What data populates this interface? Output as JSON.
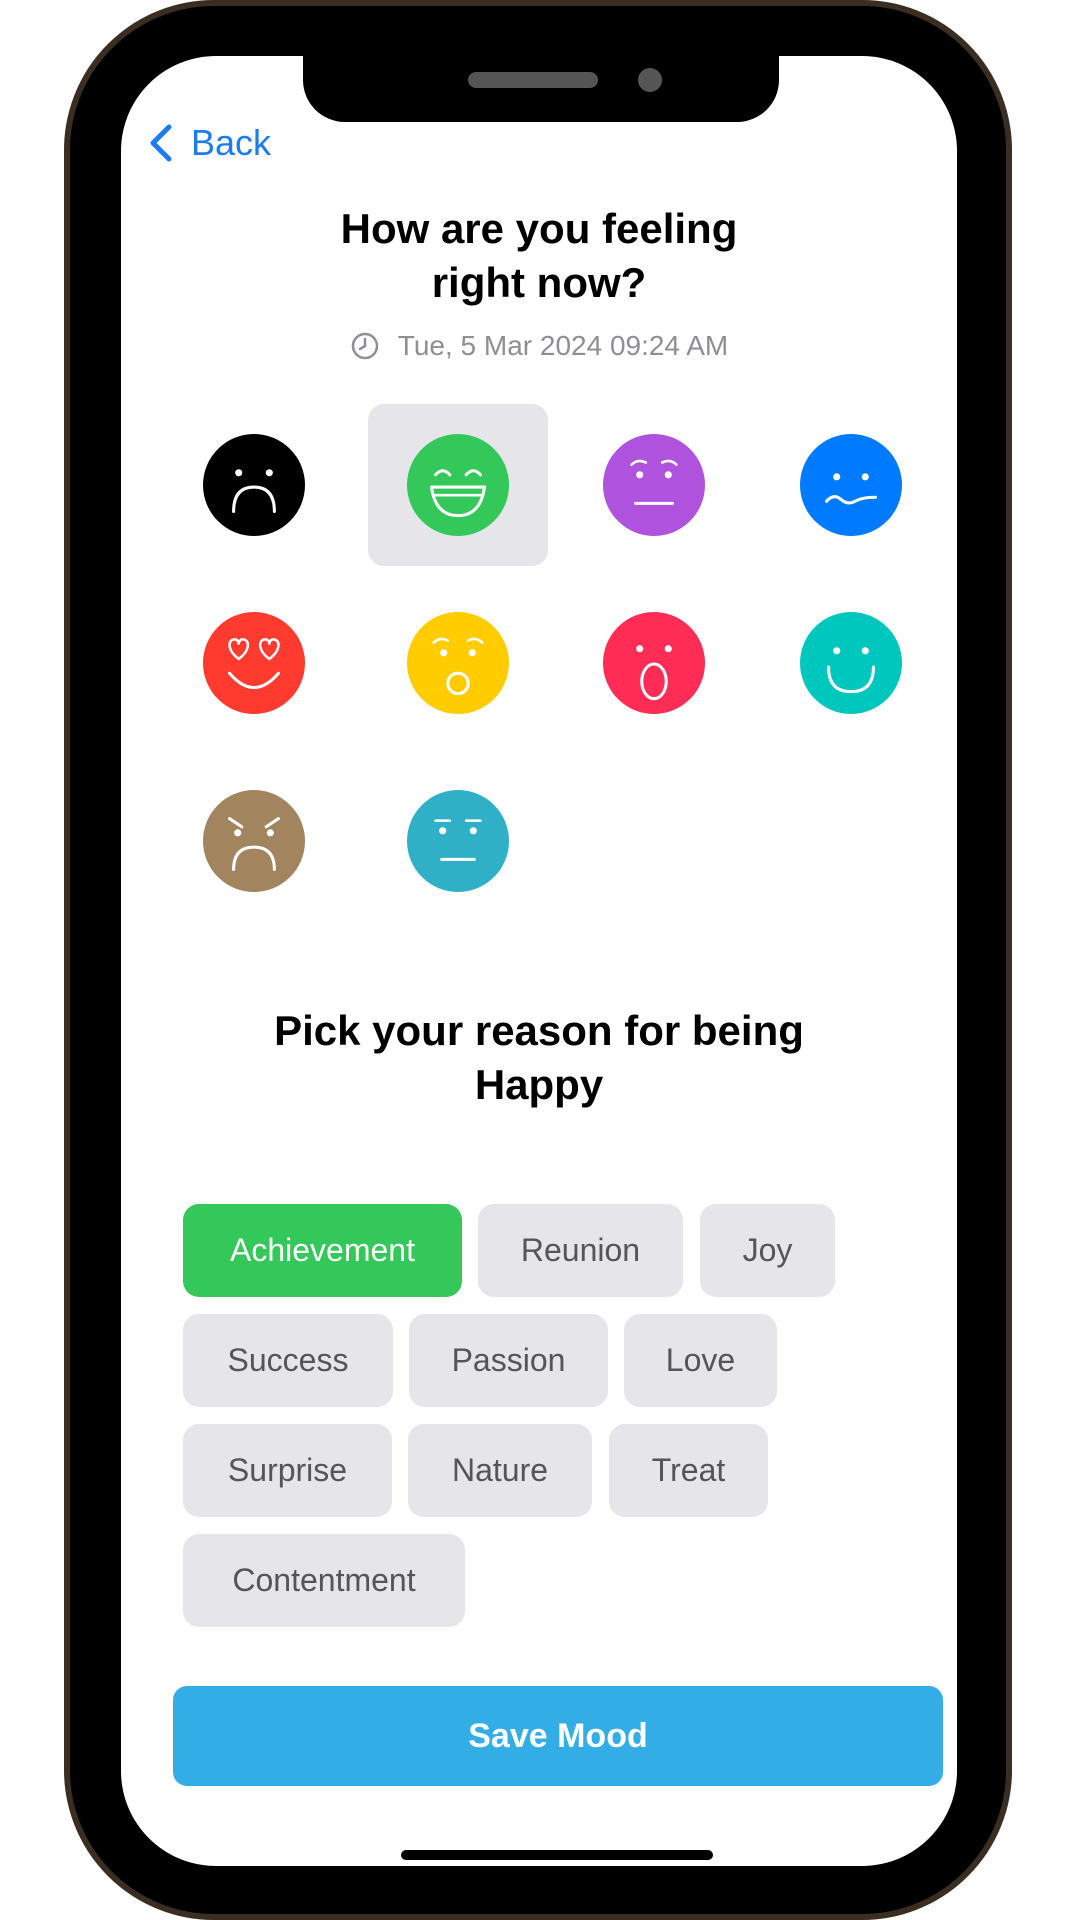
{
  "nav": {
    "back_label": "Back",
    "back_icon": "chevron-left-icon"
  },
  "header": {
    "title_line1": "How are you feeling",
    "title_line2": "right now?",
    "timestamp": "Tue, 5 Mar 2024 09:24 AM",
    "clock_icon": "clock-icon"
  },
  "moods": [
    {
      "name": "sad",
      "color": "#000000",
      "selected": false
    },
    {
      "name": "happy",
      "color": "#34c759",
      "selected": true
    },
    {
      "name": "worried",
      "color": "#af52de",
      "selected": false
    },
    {
      "name": "uneasy",
      "color": "#007aff",
      "selected": false
    },
    {
      "name": "in-love",
      "color": "#ff3b30",
      "selected": false
    },
    {
      "name": "surprised",
      "color": "#ffcc00",
      "selected": false
    },
    {
      "name": "shocked",
      "color": "#ff2d55",
      "selected": false
    },
    {
      "name": "content",
      "color": "#00c7be",
      "selected": false
    },
    {
      "name": "angry",
      "color": "#a2845e",
      "selected": false
    },
    {
      "name": "neutral",
      "color": "#30b0c7",
      "selected": false
    }
  ],
  "reason": {
    "title_line1": "Pick your reason for being",
    "title_line2": "Happy",
    "chips": [
      {
        "label": "Achievement",
        "selected": true
      },
      {
        "label": "Reunion",
        "selected": false
      },
      {
        "label": "Joy",
        "selected": false
      },
      {
        "label": "Success",
        "selected": false
      },
      {
        "label": "Passion",
        "selected": false
      },
      {
        "label": "Love",
        "selected": false
      },
      {
        "label": "Surprise",
        "selected": false
      },
      {
        "label": "Nature",
        "selected": false
      },
      {
        "label": "Treat",
        "selected": false
      },
      {
        "label": "Contentment",
        "selected": false
      }
    ]
  },
  "save_button_label": "Save Mood",
  "colors": {
    "accent_blue": "#1a7cf0",
    "save_button": "#32ade6",
    "chip_selected": "#34c759",
    "chip_default": "#e5e5ea"
  }
}
